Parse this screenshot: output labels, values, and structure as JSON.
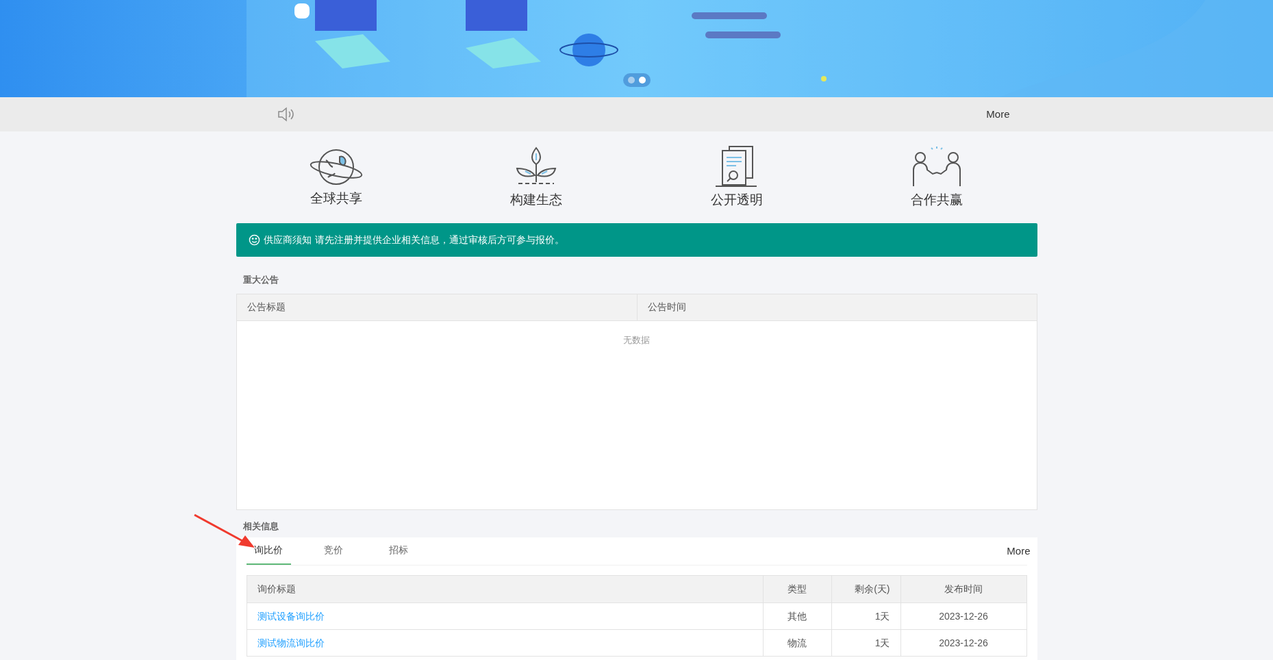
{
  "banner": {
    "dots": [
      {
        "selected": false
      },
      {
        "selected": true
      }
    ]
  },
  "notice_bar": {
    "more": "More"
  },
  "features": [
    {
      "kind": "globe",
      "label": "全球共享"
    },
    {
      "kind": "plant",
      "label": "构建生态"
    },
    {
      "kind": "document",
      "label": "公开透明"
    },
    {
      "kind": "people",
      "label": "合作共赢"
    }
  ],
  "alert": {
    "title": "供应商须知",
    "text": "请先注册并提供企业相关信息，通过审核后方可参与报价。"
  },
  "announcements": {
    "heading": "重大公告",
    "columns": [
      "公告标题",
      "公告时间"
    ],
    "empty": "无数据"
  },
  "related": {
    "heading": "相关信息",
    "tabs": [
      {
        "label": "询比价",
        "selected": true
      },
      {
        "label": "竞价",
        "selected": false
      },
      {
        "label": "招标",
        "selected": false
      }
    ],
    "more": "More",
    "columns": [
      "询价标题",
      "类型",
      "剩余(天)",
      "发布时间"
    ],
    "rows": [
      [
        "测试设备询比价",
        "其他",
        "1天",
        "2023-12-26"
      ],
      [
        "测试物流询比价",
        "物流",
        "1天",
        "2023-12-26"
      ]
    ]
  }
}
